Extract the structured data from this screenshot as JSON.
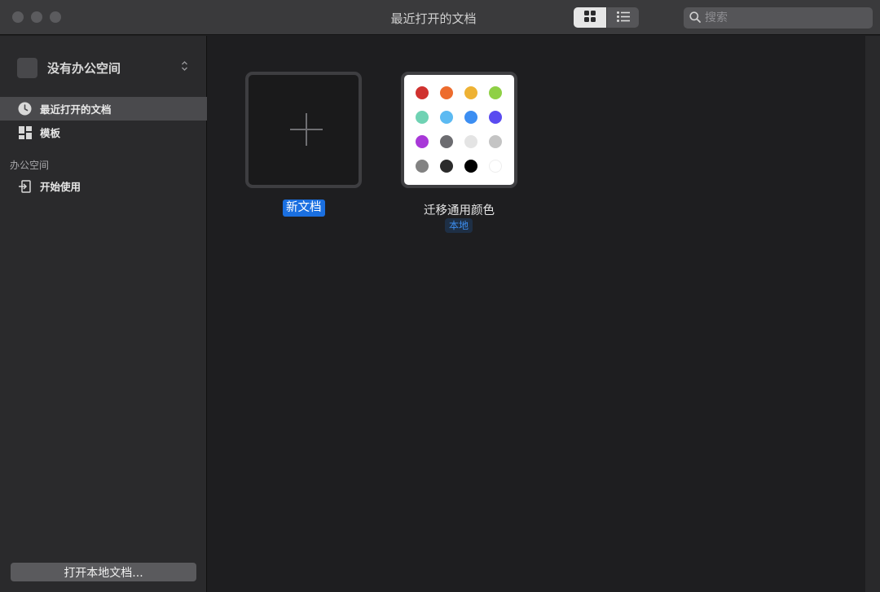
{
  "window": {
    "title": "最近打开的文档"
  },
  "toolbar": {
    "view_modes": [
      {
        "name": "grid",
        "icon": "grid-icon",
        "active": true
      },
      {
        "name": "list",
        "icon": "list-icon",
        "active": false
      }
    ],
    "search": {
      "placeholder": "搜索",
      "value": ""
    }
  },
  "sidebar": {
    "workspace": {
      "name": "没有办公空间"
    },
    "items": [
      {
        "label": "最近打开的文档",
        "icon": "clock-icon",
        "selected": true
      },
      {
        "label": "模板",
        "icon": "template-icon",
        "selected": false
      }
    ],
    "section": "办公空间",
    "section_items": [
      {
        "label": "开始使用",
        "icon": "sign-in-icon"
      }
    ],
    "open_local_button": "打开本地文档..."
  },
  "documents": [
    {
      "title": "新文档",
      "type": "new",
      "selected": true
    },
    {
      "title": "迁移通用颜色",
      "badge": "本地",
      "type": "color-palette",
      "selected": false
    }
  ],
  "palette_colors": [
    "#d0322f",
    "#ed6c2d",
    "#eeb234",
    "#8fd045",
    "#6fd2b3",
    "#5cbaf2",
    "#3c8ef2",
    "#5a4bf0",
    "#a838d8",
    "#6c6c70",
    "#e4e4e4",
    "#c4c4c4",
    "#828282",
    "#2b2b2b",
    "#000000",
    "#ffffff"
  ],
  "colors": {
    "accent": "#1a6fe0",
    "sidebar_bg": "#2a2a2c",
    "main_bg": "#1e1e20",
    "titlebar_bg": "#3a3a3c"
  }
}
